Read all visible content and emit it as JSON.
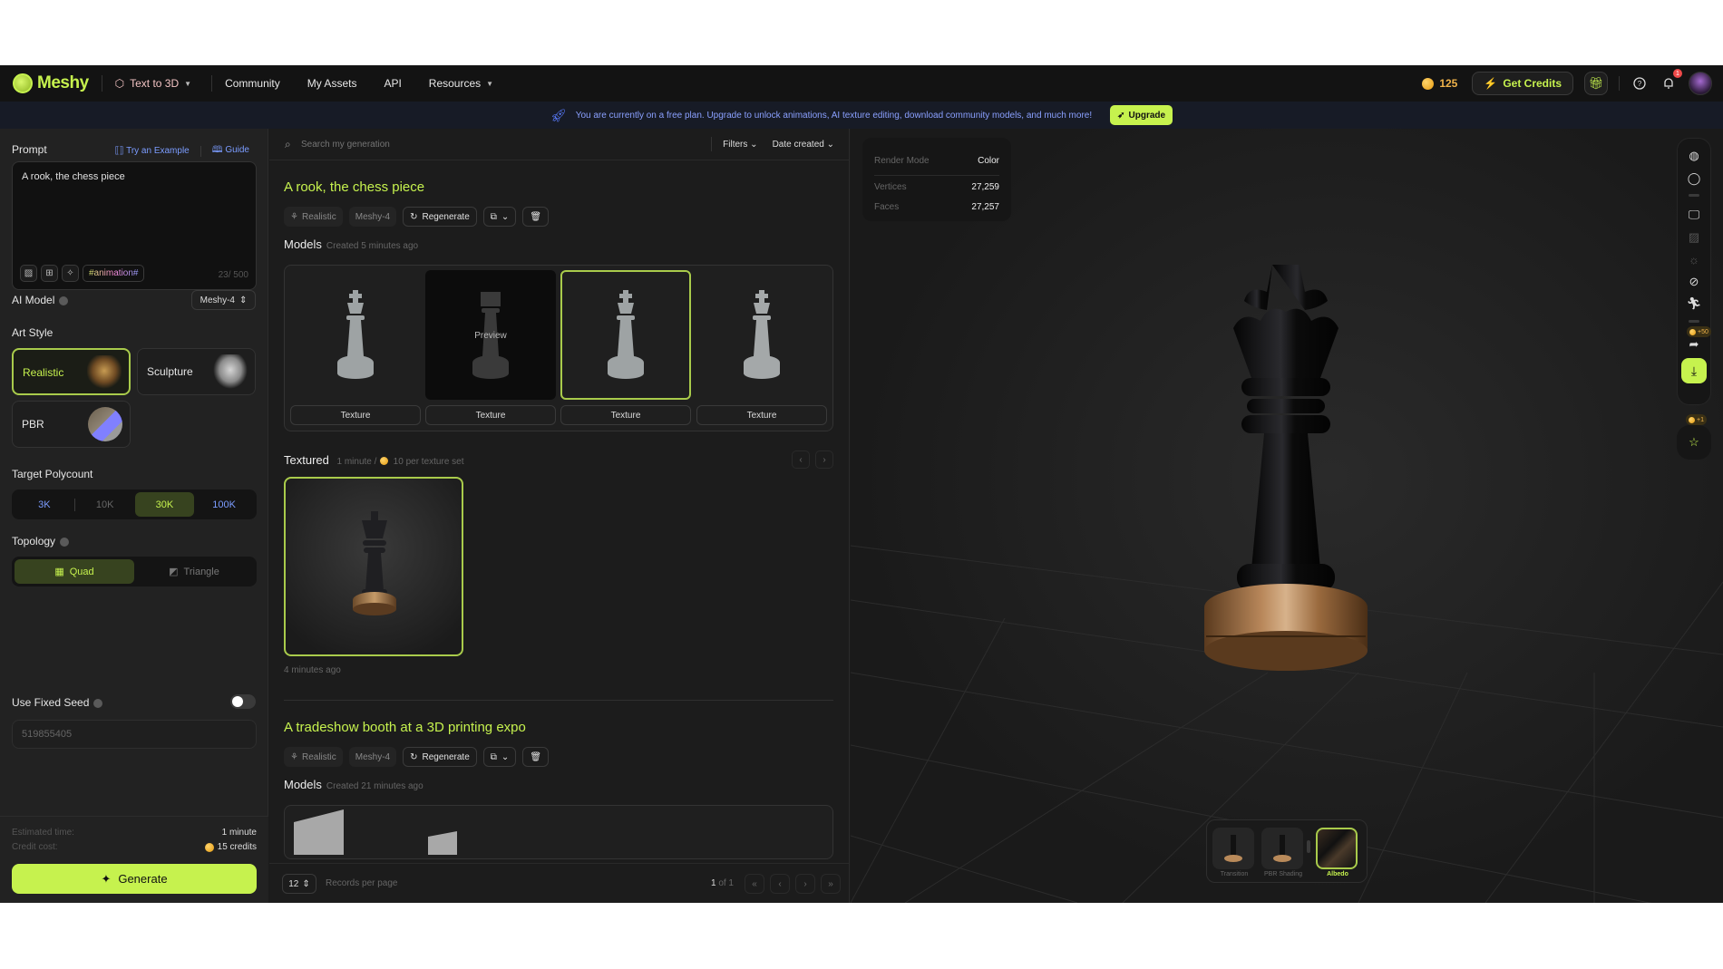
{
  "nav": {
    "logo": "Meshy",
    "mode": "Text to 3D",
    "items": [
      "Community",
      "My Assets",
      "API",
      "Resources"
    ],
    "credits": "125",
    "get_credits": "Get Credits",
    "notification_count": "1"
  },
  "banner": {
    "text": "You are currently on a free plan. Upgrade to unlock animations, AI texture editing, download community models, and much more!",
    "button": "Upgrade"
  },
  "left": {
    "prompt_label": "Prompt",
    "try_example": "Try an Example",
    "guide": "Guide",
    "prompt_value": "A rook, the chess piece",
    "animation_tag": "#animation#",
    "char_count": "23/ 500",
    "ai_model_label": "AI Model",
    "ai_model_value": "Meshy-4",
    "art_style_label": "Art Style",
    "art_styles": [
      {
        "label": "Realistic",
        "selected": true
      },
      {
        "label": "Sculpture",
        "selected": false
      },
      {
        "label": "PBR",
        "selected": false
      }
    ],
    "polycount_label": "Target Polycount",
    "polycounts": [
      {
        "label": "3K",
        "color": "#7b9cff"
      },
      {
        "label": "10K",
        "color": "#666666"
      },
      {
        "label": "30K",
        "color": "#c6f24e",
        "selected": true
      },
      {
        "label": "100K",
        "color": "#7b9cff"
      }
    ],
    "topology_label": "Topology",
    "topology": [
      {
        "label": "Quad",
        "selected": true
      },
      {
        "label": "Triangle",
        "selected": false
      }
    ],
    "fixed_seed_label": "Use Fixed Seed",
    "fixed_seed_enabled": false,
    "seed_value": "519855405",
    "estimated_time_label": "Estimated time:",
    "estimated_time_value": "1 minute",
    "credit_cost_label": "Credit cost:",
    "credit_cost_value": "15 credits",
    "generate": "Generate"
  },
  "mid": {
    "search_placeholder": "Search my generation",
    "filters": "Filters",
    "sort": "Date created",
    "generations": [
      {
        "title": "A rook, the chess piece",
        "style": "Realistic",
        "model": "Meshy-4",
        "regenerate": "Regenerate",
        "models_label": "Models",
        "models_created": "Created 5 minutes ago",
        "model_cards": [
          {
            "button": "Texture",
            "overlay": ""
          },
          {
            "button": "Texture",
            "overlay": "Preview"
          },
          {
            "button": "Texture",
            "overlay": ""
          },
          {
            "button": "Texture",
            "overlay": ""
          }
        ],
        "textured_label": "Textured",
        "textured_meta_time": "1 minute /",
        "textured_meta_cost": "10 per texture set",
        "textured_ago": "4 minutes ago"
      },
      {
        "title": "A tradeshow booth at a 3D printing expo",
        "style": "Realistic",
        "model": "Meshy-4",
        "regenerate": "Regenerate",
        "models_label": "Models",
        "models_created": "Created 21 minutes ago"
      }
    ],
    "per_page": "12",
    "records_per_page": "Records per page",
    "page_current": "1",
    "page_of": "of 1"
  },
  "viewport": {
    "render_mode_label": "Render Mode",
    "render_mode_value": "Color",
    "vertices_label": "Vertices",
    "vertices_value": "27,259",
    "faces_label": "Faces",
    "faces_value": "27,257",
    "share_bonus": "+50",
    "feedback_bonus": "+1",
    "modes": [
      {
        "label": "Transition",
        "selected": false
      },
      {
        "label": "PBR Shading",
        "selected": false
      },
      {
        "label": "Albedo",
        "selected": true
      }
    ]
  }
}
